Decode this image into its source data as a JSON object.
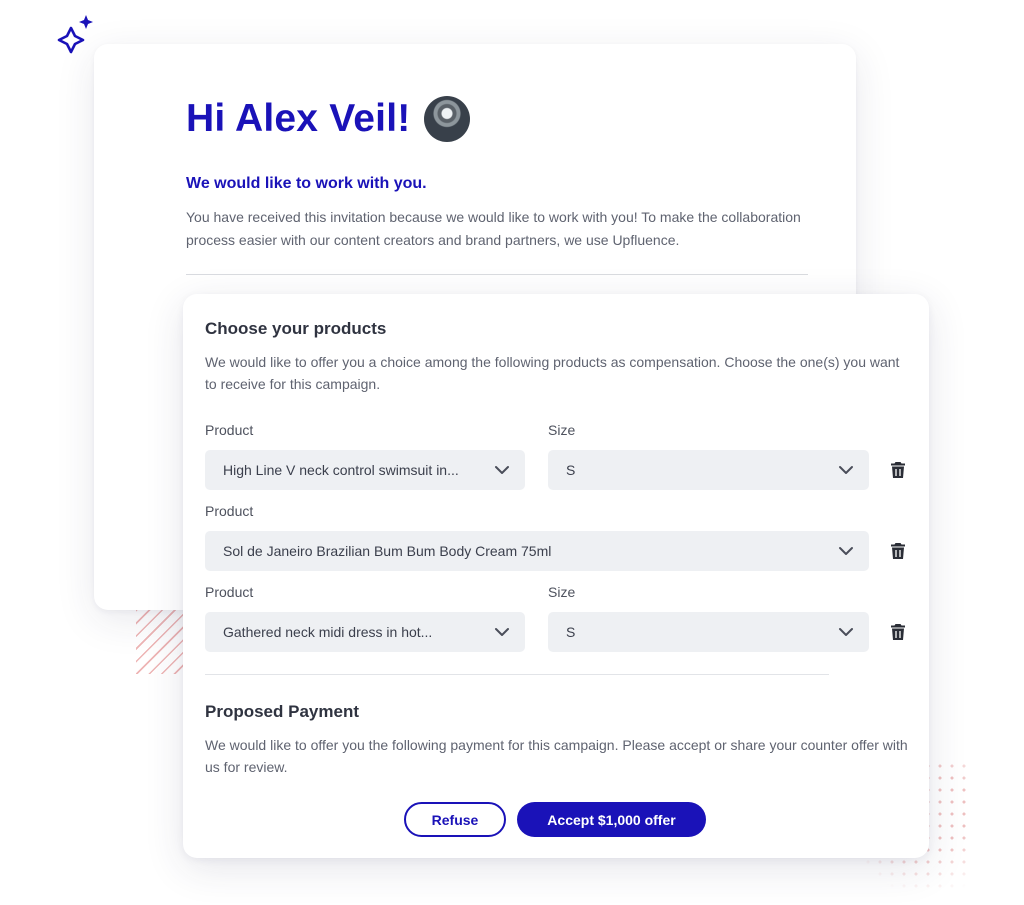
{
  "invite": {
    "greeting": "Hi Alex Veil!",
    "subtitle": "We would like to work with you.",
    "intro": "You have received this invitation because we would like to work with you! To make the collaboration process easier with our content creators and brand partners, we use Upfluence."
  },
  "products": {
    "title": "Choose your products",
    "description": "We would like to offer you a choice among the following products as compensation. Choose the one(s) you want to receive for this campaign.",
    "rows": [
      {
        "product_label": "Product",
        "product_value": "High Line V neck control swimsuit in...",
        "size_label": "Size",
        "size_value": "S"
      },
      {
        "product_label": "Product",
        "product_value": "Sol de Janeiro Brazilian Bum Bum Body Cream 75ml"
      },
      {
        "product_label": "Product",
        "product_value": "Gathered neck midi dress in hot...",
        "size_label": "Size",
        "size_value": "S"
      }
    ]
  },
  "payment": {
    "title": "Proposed Payment",
    "description": "We would like to offer you the following payment for this campaign. Please accept or share your counter offer with us for review.",
    "refuse_label": "Refuse",
    "accept_label": "Accept $1,000 offer"
  },
  "icons": {
    "chevron": "chevron-down-icon",
    "delete": "trash-icon",
    "decoration": "sparkle-icon"
  },
  "colors": {
    "brand": "#1a12b8",
    "field_bg": "#eef0f3"
  }
}
